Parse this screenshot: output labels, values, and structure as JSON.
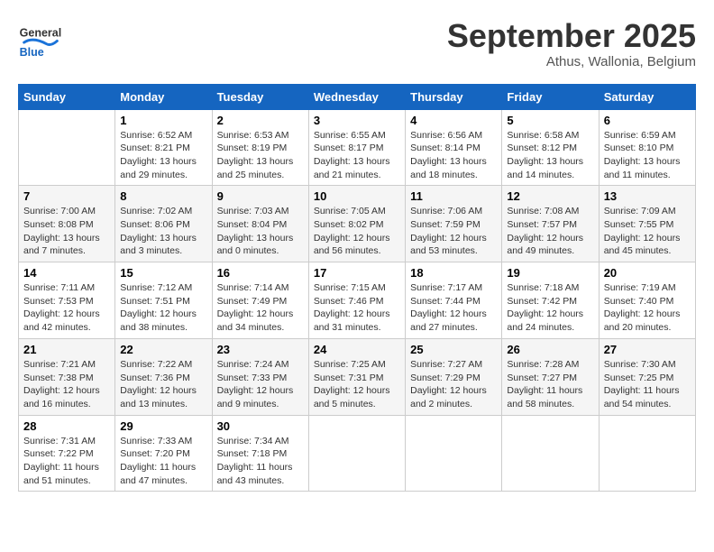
{
  "header": {
    "logo_line1": "General",
    "logo_line2": "Blue",
    "month": "September 2025",
    "location": "Athus, Wallonia, Belgium"
  },
  "days_of_week": [
    "Sunday",
    "Monday",
    "Tuesday",
    "Wednesday",
    "Thursday",
    "Friday",
    "Saturday"
  ],
  "weeks": [
    [
      {
        "day": "",
        "sunrise": "",
        "sunset": "",
        "daylight": ""
      },
      {
        "day": "1",
        "sunrise": "Sunrise: 6:52 AM",
        "sunset": "Sunset: 8:21 PM",
        "daylight": "Daylight: 13 hours and 29 minutes."
      },
      {
        "day": "2",
        "sunrise": "Sunrise: 6:53 AM",
        "sunset": "Sunset: 8:19 PM",
        "daylight": "Daylight: 13 hours and 25 minutes."
      },
      {
        "day": "3",
        "sunrise": "Sunrise: 6:55 AM",
        "sunset": "Sunset: 8:17 PM",
        "daylight": "Daylight: 13 hours and 21 minutes."
      },
      {
        "day": "4",
        "sunrise": "Sunrise: 6:56 AM",
        "sunset": "Sunset: 8:14 PM",
        "daylight": "Daylight: 13 hours and 18 minutes."
      },
      {
        "day": "5",
        "sunrise": "Sunrise: 6:58 AM",
        "sunset": "Sunset: 8:12 PM",
        "daylight": "Daylight: 13 hours and 14 minutes."
      },
      {
        "day": "6",
        "sunrise": "Sunrise: 6:59 AM",
        "sunset": "Sunset: 8:10 PM",
        "daylight": "Daylight: 13 hours and 11 minutes."
      }
    ],
    [
      {
        "day": "7",
        "sunrise": "Sunrise: 7:00 AM",
        "sunset": "Sunset: 8:08 PM",
        "daylight": "Daylight: 13 hours and 7 minutes."
      },
      {
        "day": "8",
        "sunrise": "Sunrise: 7:02 AM",
        "sunset": "Sunset: 8:06 PM",
        "daylight": "Daylight: 13 hours and 3 minutes."
      },
      {
        "day": "9",
        "sunrise": "Sunrise: 7:03 AM",
        "sunset": "Sunset: 8:04 PM",
        "daylight": "Daylight: 13 hours and 0 minutes."
      },
      {
        "day": "10",
        "sunrise": "Sunrise: 7:05 AM",
        "sunset": "Sunset: 8:02 PM",
        "daylight": "Daylight: 12 hours and 56 minutes."
      },
      {
        "day": "11",
        "sunrise": "Sunrise: 7:06 AM",
        "sunset": "Sunset: 7:59 PM",
        "daylight": "Daylight: 12 hours and 53 minutes."
      },
      {
        "day": "12",
        "sunrise": "Sunrise: 7:08 AM",
        "sunset": "Sunset: 7:57 PM",
        "daylight": "Daylight: 12 hours and 49 minutes."
      },
      {
        "day": "13",
        "sunrise": "Sunrise: 7:09 AM",
        "sunset": "Sunset: 7:55 PM",
        "daylight": "Daylight: 12 hours and 45 minutes."
      }
    ],
    [
      {
        "day": "14",
        "sunrise": "Sunrise: 7:11 AM",
        "sunset": "Sunset: 7:53 PM",
        "daylight": "Daylight: 12 hours and 42 minutes."
      },
      {
        "day": "15",
        "sunrise": "Sunrise: 7:12 AM",
        "sunset": "Sunset: 7:51 PM",
        "daylight": "Daylight: 12 hours and 38 minutes."
      },
      {
        "day": "16",
        "sunrise": "Sunrise: 7:14 AM",
        "sunset": "Sunset: 7:49 PM",
        "daylight": "Daylight: 12 hours and 34 minutes."
      },
      {
        "day": "17",
        "sunrise": "Sunrise: 7:15 AM",
        "sunset": "Sunset: 7:46 PM",
        "daylight": "Daylight: 12 hours and 31 minutes."
      },
      {
        "day": "18",
        "sunrise": "Sunrise: 7:17 AM",
        "sunset": "Sunset: 7:44 PM",
        "daylight": "Daylight: 12 hours and 27 minutes."
      },
      {
        "day": "19",
        "sunrise": "Sunrise: 7:18 AM",
        "sunset": "Sunset: 7:42 PM",
        "daylight": "Daylight: 12 hours and 24 minutes."
      },
      {
        "day": "20",
        "sunrise": "Sunrise: 7:19 AM",
        "sunset": "Sunset: 7:40 PM",
        "daylight": "Daylight: 12 hours and 20 minutes."
      }
    ],
    [
      {
        "day": "21",
        "sunrise": "Sunrise: 7:21 AM",
        "sunset": "Sunset: 7:38 PM",
        "daylight": "Daylight: 12 hours and 16 minutes."
      },
      {
        "day": "22",
        "sunrise": "Sunrise: 7:22 AM",
        "sunset": "Sunset: 7:36 PM",
        "daylight": "Daylight: 12 hours and 13 minutes."
      },
      {
        "day": "23",
        "sunrise": "Sunrise: 7:24 AM",
        "sunset": "Sunset: 7:33 PM",
        "daylight": "Daylight: 12 hours and 9 minutes."
      },
      {
        "day": "24",
        "sunrise": "Sunrise: 7:25 AM",
        "sunset": "Sunset: 7:31 PM",
        "daylight": "Daylight: 12 hours and 5 minutes."
      },
      {
        "day": "25",
        "sunrise": "Sunrise: 7:27 AM",
        "sunset": "Sunset: 7:29 PM",
        "daylight": "Daylight: 12 hours and 2 minutes."
      },
      {
        "day": "26",
        "sunrise": "Sunrise: 7:28 AM",
        "sunset": "Sunset: 7:27 PM",
        "daylight": "Daylight: 11 hours and 58 minutes."
      },
      {
        "day": "27",
        "sunrise": "Sunrise: 7:30 AM",
        "sunset": "Sunset: 7:25 PM",
        "daylight": "Daylight: 11 hours and 54 minutes."
      }
    ],
    [
      {
        "day": "28",
        "sunrise": "Sunrise: 7:31 AM",
        "sunset": "Sunset: 7:22 PM",
        "daylight": "Daylight: 11 hours and 51 minutes."
      },
      {
        "day": "29",
        "sunrise": "Sunrise: 7:33 AM",
        "sunset": "Sunset: 7:20 PM",
        "daylight": "Daylight: 11 hours and 47 minutes."
      },
      {
        "day": "30",
        "sunrise": "Sunrise: 7:34 AM",
        "sunset": "Sunset: 7:18 PM",
        "daylight": "Daylight: 11 hours and 43 minutes."
      },
      {
        "day": "",
        "sunrise": "",
        "sunset": "",
        "daylight": ""
      },
      {
        "day": "",
        "sunrise": "",
        "sunset": "",
        "daylight": ""
      },
      {
        "day": "",
        "sunrise": "",
        "sunset": "",
        "daylight": ""
      },
      {
        "day": "",
        "sunrise": "",
        "sunset": "",
        "daylight": ""
      }
    ]
  ]
}
